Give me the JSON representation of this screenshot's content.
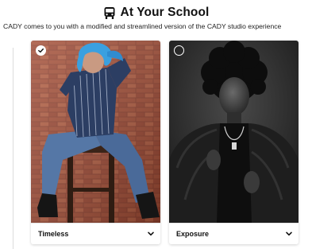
{
  "header": {
    "title": "At Your School",
    "icon": "bus-icon"
  },
  "subtitle": "CADY comes to you with a modified and streamlined version of the CADY studio experience",
  "options": [
    {
      "label": "Timeless",
      "selected": true,
      "image": "woman-blue-hair-brick-wall-photo"
    },
    {
      "label": "Exposure",
      "selected": false,
      "image": "man-black-white-portrait-photo"
    }
  ],
  "colors": {
    "text": "#111111",
    "card_bg": "#ffffff",
    "photo_left_brick": "#8a3e2c",
    "photo_right_bg": "#2a2a2a"
  }
}
